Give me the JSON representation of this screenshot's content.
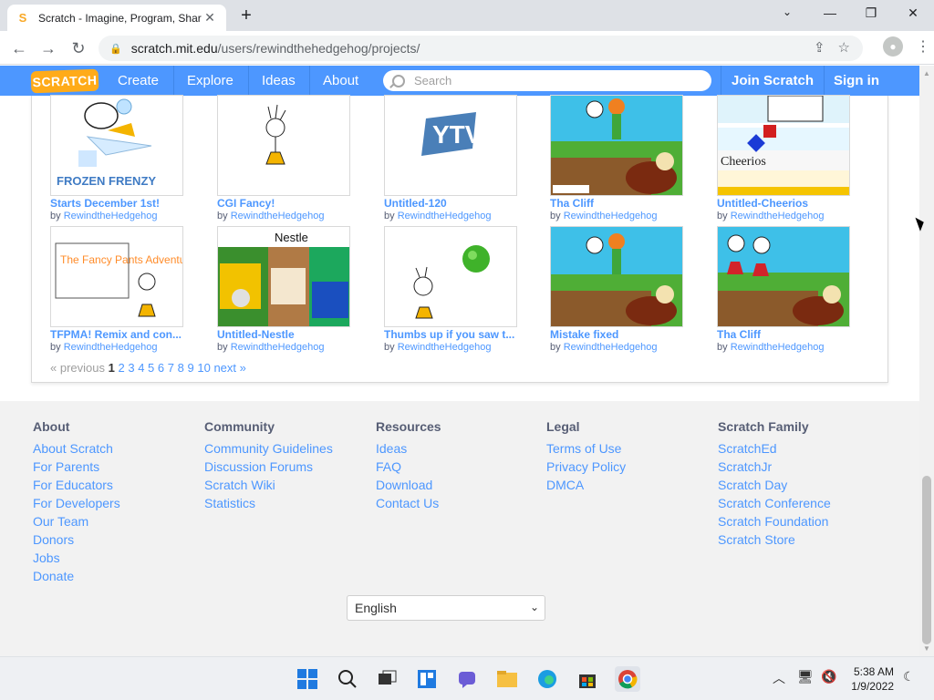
{
  "browser": {
    "tab_title": "Scratch - Imagine, Program, Shar",
    "tab_close": "✕",
    "new_tab": "+",
    "url_host": "scratch.mit.edu",
    "url_path": "/users/rewindthehedgehog/projects/",
    "window_minimize": "—",
    "window_restore": "❐",
    "window_close": "✕"
  },
  "nav": {
    "logo": "SCRATCH",
    "create": "Create",
    "explore": "Explore",
    "ideas": "Ideas",
    "about": "About",
    "search_placeholder": "Search",
    "join": "Join Scratch",
    "signin": "Sign in"
  },
  "projects": [
    {
      "title": "Starts December 1st!",
      "by": "by",
      "author": "RewindtheHedgehog",
      "thumb_text": "FROZEN FRENZY"
    },
    {
      "title": "CGI Fancy!",
      "by": "by",
      "author": "RewindtheHedgehog"
    },
    {
      "title": "Untitled-120",
      "by": "by",
      "author": "RewindtheHedgehog",
      "thumb_text": "YTV"
    },
    {
      "title": "Tha Cliff",
      "by": "by",
      "author": "RewindtheHedgehog"
    },
    {
      "title": "Untitled-Cheerios",
      "by": "by",
      "author": "RewindtheHedgehog",
      "thumb_text": "Cheerios"
    },
    {
      "title": "TFPMA! Remix and con...",
      "by": "by",
      "author": "RewindtheHedgehog",
      "thumb_text": "The Fancy Pants Adventures"
    },
    {
      "title": "Untitled-Nestle",
      "by": "by",
      "author": "RewindtheHedgehog",
      "thumb_text": "Nestle"
    },
    {
      "title": "Thumbs up if you saw t...",
      "by": "by",
      "author": "RewindtheHedgehog"
    },
    {
      "title": "Mistake fixed",
      "by": "by",
      "author": "RewindtheHedgehog"
    },
    {
      "title": "Tha Cliff",
      "by": "by",
      "author": "RewindtheHedgehog"
    }
  ],
  "pagination": {
    "previous": "« previous",
    "current": "1",
    "pages": [
      "2",
      "3",
      "4",
      "5",
      "6",
      "7",
      "8",
      "9",
      "10"
    ],
    "next": "next »"
  },
  "footer": {
    "columns": [
      {
        "heading": "About",
        "links": [
          "About Scratch",
          "For Parents",
          "For Educators",
          "For Developers",
          "Our Team",
          "Donors",
          "Jobs",
          "Donate"
        ]
      },
      {
        "heading": "Community",
        "links": [
          "Community Guidelines",
          "Discussion Forums",
          "Scratch Wiki",
          "Statistics"
        ]
      },
      {
        "heading": "Resources",
        "links": [
          "Ideas",
          "FAQ",
          "Download",
          "Contact Us"
        ]
      },
      {
        "heading": "Legal",
        "links": [
          "Terms of Use",
          "Privacy Policy",
          "DMCA"
        ]
      },
      {
        "heading": "Scratch Family",
        "links": [
          "ScratchEd",
          "ScratchJr",
          "Scratch Day",
          "Scratch Conference",
          "Scratch Foundation",
          "Scratch Store"
        ]
      }
    ],
    "language": "English"
  },
  "taskbar": {
    "time": "5:38 AM",
    "date": "1/9/2022"
  },
  "colors": {
    "scratch_blue": "#4d97ff",
    "scratch_orange": "#ffab19"
  }
}
